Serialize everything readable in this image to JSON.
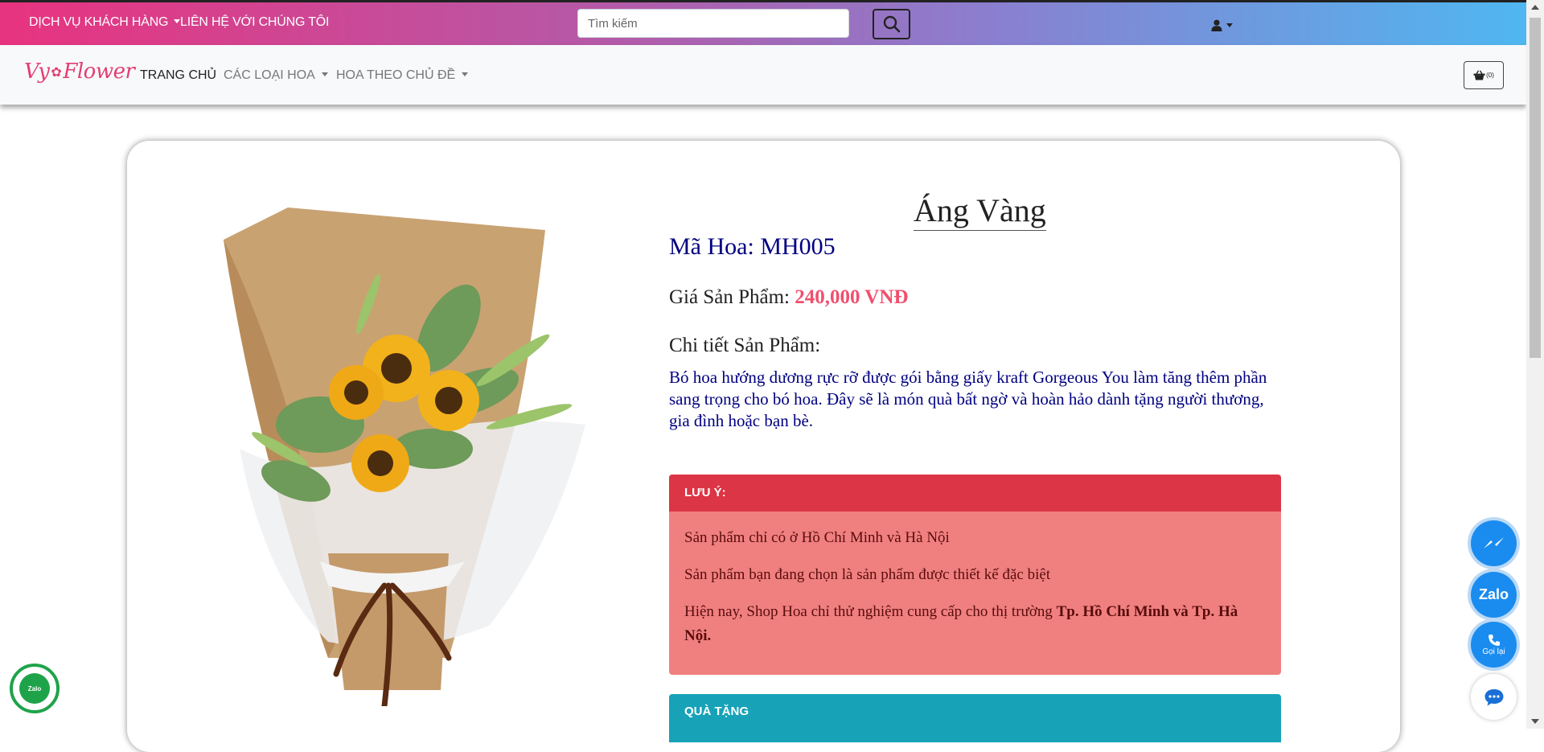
{
  "topbar": {
    "customer_service": "DỊCH VỤ KHÁCH HÀNG",
    "contact_us": "LIÊN HỆ VỚI CHÚNG TÔI",
    "search_placeholder": "Tìm kiếm"
  },
  "nav": {
    "logo_part1": "Vy",
    "logo_part2": "Flower",
    "home": "TRANG CHỦ",
    "flower_types": "CÁC LOẠI HOA",
    "flowers_by_theme": "HOA THEO CHỦ ĐỀ",
    "cart_count": "(0)"
  },
  "product": {
    "name": "Áng Vàng",
    "code_label": "Mã Hoa: ",
    "code": "MH005",
    "price_label": "Giá Sản Phẩm: ",
    "price": "240,000 VNĐ",
    "detail_label": "Chi tiết Sản Phẩm:",
    "detail_text": "Bó hoa hướng dương rực rỡ được gói bằng giấy kraft Gorgeous You làm tăng thêm phần sang trọng cho bó hoa. Đây sẽ là món quà bất ngờ và hoàn hảo dành tặng người thương, gia đình hoặc bạn bè."
  },
  "note": {
    "title": "LƯU Ý:",
    "line1": "Sản phẩm chỉ có ở Hồ Chí Minh và Hà Nội",
    "line2": "Sản phẩm bạn đang chọn là sản phẩm được thiết kế đặc biệt",
    "line3_prefix": "Hiện nay, Shop Hoa chỉ thử nghiệm cung cấp cho thị trường ",
    "line3_bold": "Tp. Hồ Chí Minh và Tp. Hà Nội."
  },
  "gift": {
    "title": "QUÀ TẶNG"
  },
  "floating": {
    "zalo": "Zalo",
    "call_back": "Gọi lại",
    "zalo_corner": "Zalo"
  },
  "colors": {
    "gradient_start": "#e8337f",
    "gradient_end": "#4fb7f0",
    "price": "#f0506e",
    "note_header": "#dc3545",
    "note_body": "#f08080",
    "gift_header": "#17a2b8",
    "product_code": "#000080"
  }
}
